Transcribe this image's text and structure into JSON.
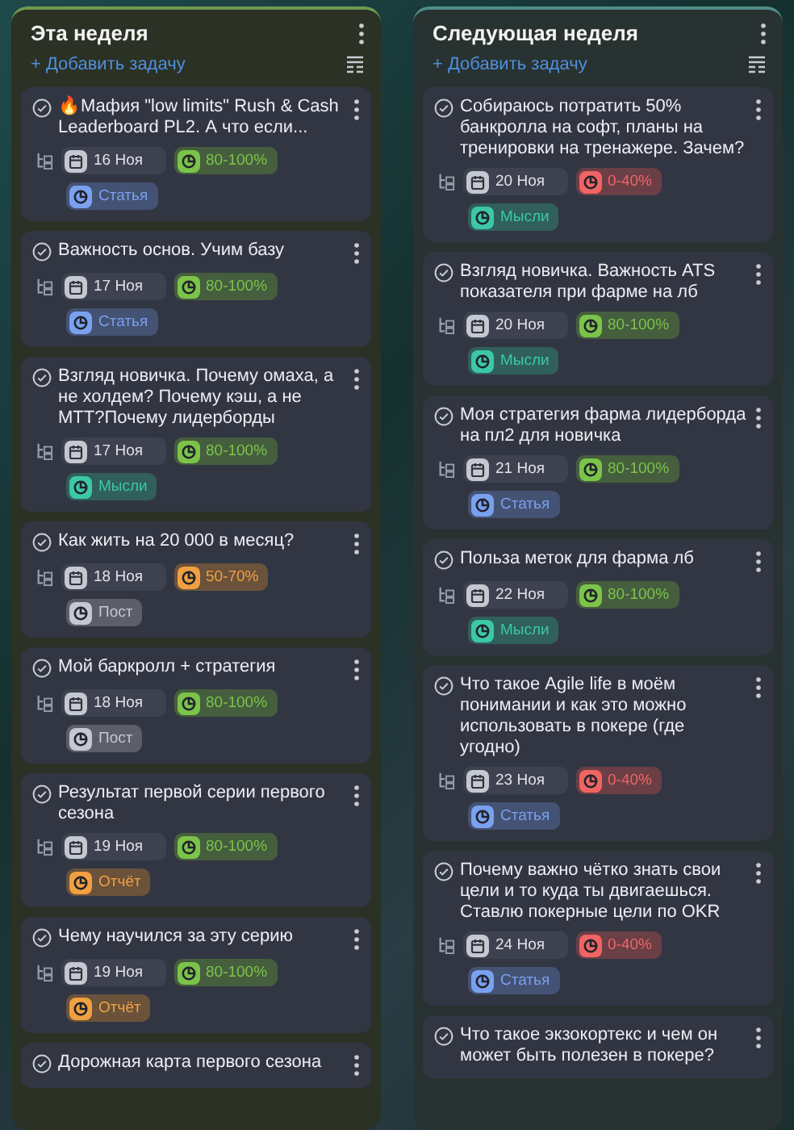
{
  "columns": [
    {
      "title": "Эта неделя",
      "add_label": "+ Добавить задачу",
      "cards": [
        {
          "title": "🔥Мафия \"low limits\" Rush & Cash Leaderboard PL2. А что если...",
          "date": "16 Ноя",
          "progress": {
            "label": "80-100%",
            "color": "#7cc34a"
          },
          "tag": {
            "label": "Статья",
            "color": "#7aa0f0"
          }
        },
        {
          "title": "Важность основ. Учим базу",
          "date": "17 Ноя",
          "progress": {
            "label": "80-100%",
            "color": "#7cc34a"
          },
          "tag": {
            "label": "Статья",
            "color": "#7aa0f0"
          }
        },
        {
          "title": "Взгляд новичка. Почему омаха, а не холдем? Почему кэш, а не МТТ?Почему лидерборды",
          "date": "17 Ноя",
          "progress": {
            "label": "80-100%",
            "color": "#7cc34a"
          },
          "tag": {
            "label": "Мысли",
            "color": "#3cc8a8"
          }
        },
        {
          "title": "Как жить на 20 000 в месяц?",
          "date": "18 Ноя",
          "progress": {
            "label": "50-70%",
            "color": "#f0a040"
          },
          "tag": {
            "label": "Пост",
            "color": "#c4c8d0"
          }
        },
        {
          "title": "Мой баркролл + стратегия",
          "date": "18 Ноя",
          "progress": {
            "label": "80-100%",
            "color": "#7cc34a"
          },
          "tag": {
            "label": "Пост",
            "color": "#c4c8d0"
          }
        },
        {
          "title": "Результат первой серии первого сезона",
          "date": "19 Ноя",
          "progress": {
            "label": "80-100%",
            "color": "#7cc34a"
          },
          "tag": {
            "label": "Отчёт",
            "color": "#f0a040"
          }
        },
        {
          "title": "Чему научился за эту серию",
          "date": "19 Ноя",
          "progress": {
            "label": "80-100%",
            "color": "#7cc34a"
          },
          "tag": {
            "label": "Отчёт",
            "color": "#f0a040"
          }
        },
        {
          "title": "Дорожная карта первого сезона"
        }
      ]
    },
    {
      "title": "Следующая неделя",
      "add_label": "+ Добавить задачу",
      "cards": [
        {
          "title": "Собираюсь потратить 50% банкролла на софт, планы на тренировки на тренажере. Зачем?",
          "date": "20 Ноя",
          "progress": {
            "label": "0-40%",
            "color": "#f06464"
          },
          "tag": {
            "label": "Мысли",
            "color": "#3cc8a8"
          }
        },
        {
          "title": "Взгляд новичка. Важность ATS показателя при фарме на лб",
          "date": "20 Ноя",
          "progress": {
            "label": "80-100%",
            "color": "#7cc34a"
          },
          "tag": {
            "label": "Мысли",
            "color": "#3cc8a8"
          }
        },
        {
          "title": "Моя стратегия фарма лидерборда на пл2 для новичка",
          "date": "21 Ноя",
          "progress": {
            "label": "80-100%",
            "color": "#7cc34a"
          },
          "tag": {
            "label": "Статья",
            "color": "#7aa0f0"
          }
        },
        {
          "title": "Польза меток для фарма лб",
          "date": "22 Ноя",
          "progress": {
            "label": "80-100%",
            "color": "#7cc34a"
          },
          "tag": {
            "label": "Мысли",
            "color": "#3cc8a8"
          }
        },
        {
          "title": "Что такое Agile life в моём понимании и как это можно использовать в покере (где угодно)",
          "date": "23 Ноя",
          "progress": {
            "label": "0-40%",
            "color": "#f06464"
          },
          "tag": {
            "label": "Статья",
            "color": "#7aa0f0"
          }
        },
        {
          "title": "Почему важно чётко знать свои цели и то куда ты двигаешься. Ставлю покерные цели по OKR",
          "date": "24 Ноя",
          "progress": {
            "label": "0-40%",
            "color": "#f06464"
          },
          "tag": {
            "label": "Статья",
            "color": "#7aa0f0"
          }
        },
        {
          "title": "Что такое экзокортекс и чем он может быть полезен в покере?"
        }
      ]
    }
  ]
}
